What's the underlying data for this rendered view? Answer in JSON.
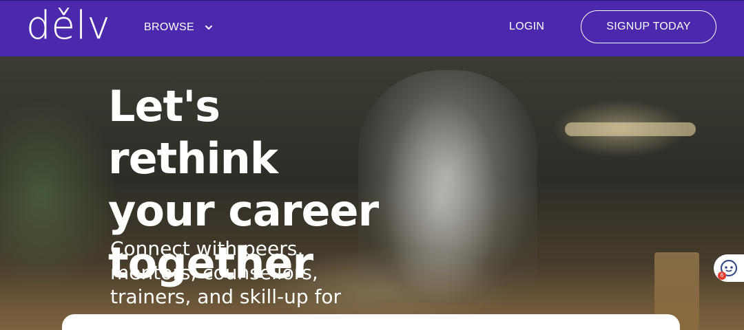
{
  "nav": {
    "logo_text": "dělv",
    "browse_label": "BROWSE",
    "login_label": "LOGIN",
    "signup_label": "SIGNUP TODAY"
  },
  "hero": {
    "headline_lines": [
      "Let's rethink",
      "your career",
      "together"
    ],
    "subline_lines": [
      "Connect with peers,",
      "mentors, counsellors,",
      "trainers, and skill-up for"
    ]
  },
  "chat": {
    "badge_count": "6",
    "icon": "chat-bot-icon"
  },
  "colors": {
    "brand": "#4a29ad",
    "text_on_brand": "#ffffff",
    "badge": "#e23b2e"
  }
}
